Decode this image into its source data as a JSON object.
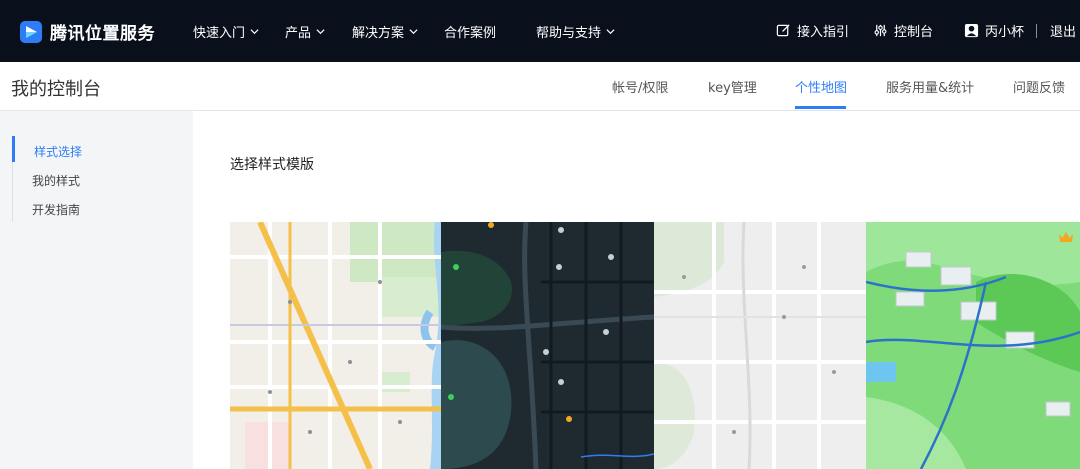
{
  "brand": {
    "name": "腾讯位置服务"
  },
  "topnav": {
    "items": [
      {
        "label": "快速入门",
        "has_dropdown": true
      },
      {
        "label": "产品",
        "has_dropdown": true
      },
      {
        "label": "解决方案",
        "has_dropdown": true
      },
      {
        "label": "合作案例",
        "has_dropdown": false
      },
      {
        "label": "帮助与支持",
        "has_dropdown": true
      }
    ],
    "right": {
      "guide_label": "接入指引",
      "console_label": "控制台",
      "user_label": "丙小杯",
      "logout_label": "退出"
    }
  },
  "subheader": {
    "title": "我的控制台",
    "tabs": [
      {
        "label": "帐号/权限",
        "active": false
      },
      {
        "label": "key管理",
        "active": false
      },
      {
        "label": "个性地图",
        "active": true
      },
      {
        "label": "服务用量&统计",
        "active": false
      },
      {
        "label": "问题反馈",
        "active": false
      }
    ]
  },
  "sidebar": {
    "items": [
      {
        "label": "样式选择",
        "active": true
      },
      {
        "label": "我的样式",
        "active": false
      },
      {
        "label": "开发指南",
        "active": false
      }
    ]
  },
  "main": {
    "section_title": "选择样式模版",
    "templates": [
      {
        "name": "standard-light-map",
        "premium": false
      },
      {
        "name": "dark-night-map",
        "premium": false
      },
      {
        "name": "gray-minimal-map",
        "premium": false
      },
      {
        "name": "green-3d-map",
        "premium": true
      }
    ]
  },
  "colors": {
    "nav_bg": "#0a0f1c",
    "accent": "#2f7df6",
    "crown": "#f5a623"
  }
}
